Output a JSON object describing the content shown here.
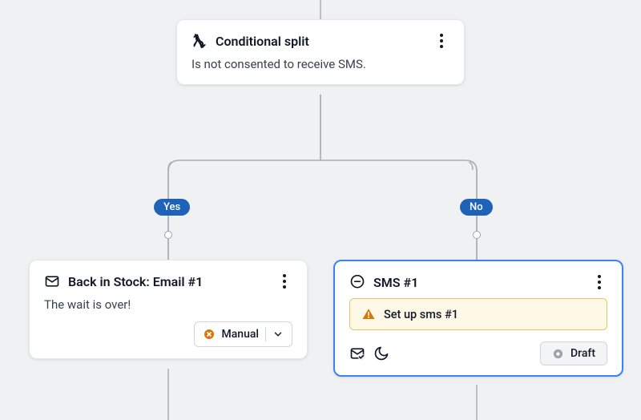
{
  "conditional": {
    "title": "Conditional split",
    "description": "Is not consented to receive SMS."
  },
  "branches": {
    "yes_label": "Yes",
    "no_label": "No"
  },
  "email_card": {
    "title": "Back in Stock: Email #1",
    "body": "The wait is over!",
    "status_label": "Manual"
  },
  "sms_card": {
    "title": "SMS #1",
    "alert_text": "Set up sms #1",
    "status_label": "Draft"
  }
}
